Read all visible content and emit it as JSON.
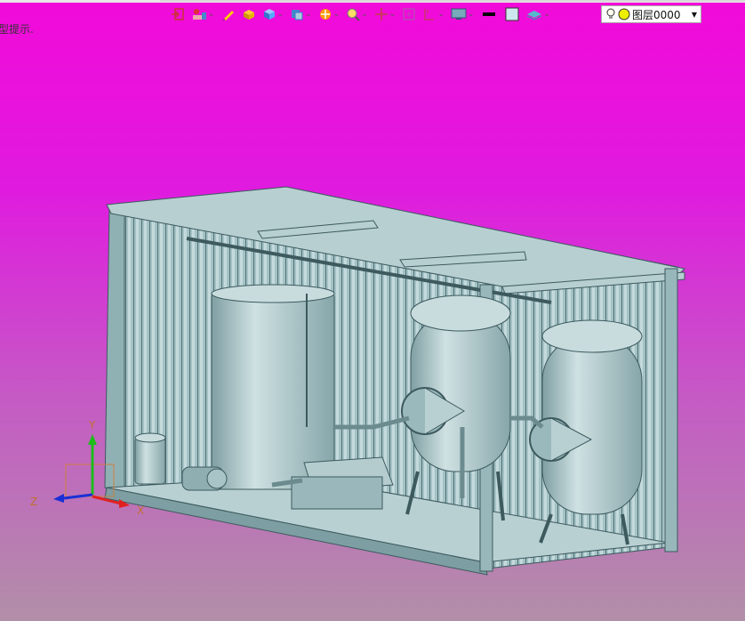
{
  "hint_text": "型提示.",
  "layer": {
    "label": "图层0000"
  },
  "toolbar": [
    {
      "name": "exit-sketch-icon",
      "dropdown": false
    },
    {
      "name": "stamp-icon",
      "dropdown": true
    },
    {
      "name": "pencil-icon",
      "dropdown": false
    },
    {
      "name": "face-render-icon",
      "dropdown": false
    },
    {
      "name": "cube-icon",
      "dropdown": true
    },
    {
      "name": "view-cube-icon",
      "dropdown": true
    },
    {
      "name": "orbit-icon",
      "dropdown": true
    },
    {
      "name": "zoom-icon",
      "dropdown": true
    },
    {
      "name": "pan-icon",
      "dropdown": true
    },
    {
      "name": "fit-view-icon",
      "dropdown": false
    },
    {
      "name": "section-icon",
      "dropdown": true
    },
    {
      "name": "display-mode-icon",
      "dropdown": true
    },
    {
      "name": "line-color-icon",
      "dropdown": false
    },
    {
      "name": "fill-color-icon",
      "dropdown": false
    },
    {
      "name": "layer-stack-icon",
      "dropdown": true
    }
  ],
  "axes": {
    "x": "X",
    "y": "Y",
    "z": "Z"
  },
  "colors": {
    "model": "#a7c6c8",
    "model_dark": "#5e7f84",
    "bg_top": "#f20ad9",
    "bg_bottom": "#b28fa8"
  }
}
